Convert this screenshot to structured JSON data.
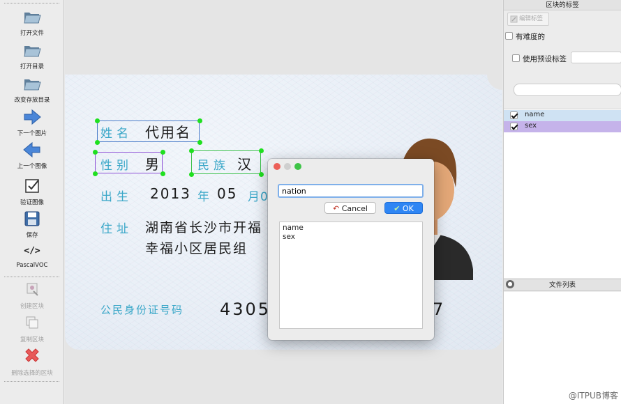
{
  "toolbar": {
    "open_file": "打开文件",
    "open_dir": "打开目录",
    "change_save_dir": "改变存放目录",
    "next_image": "下一个图片",
    "prev_image": "上一个图像",
    "verify_image": "验证图像",
    "save": "保存",
    "format_icon": "</>",
    "format": "PascalVOC",
    "create_box": "创建区块",
    "duplicate_box": "复制区块",
    "delete_box": "删除选择的区块"
  },
  "card": {
    "name_label": "姓名",
    "name_value": "代用名",
    "sex_label": "性别",
    "sex_value": "男",
    "nation_label": "民族",
    "nation_value": "汉",
    "birth_label": "出生",
    "birth_year": "2013",
    "year_char": "年",
    "birth_month": "05",
    "month_partial": "月0",
    "address_label": "住址",
    "address_line1": "湖南省长沙市开福",
    "address_line2": "幸福小区居民组",
    "id_label": "公民身份证号码",
    "id_left": "4305",
    "id_right": "7"
  },
  "dialog": {
    "input_value": "nation",
    "cancel_label": "Cancel",
    "ok_label": "OK",
    "list": [
      "name",
      "sex"
    ]
  },
  "right_panel": {
    "title": "区块的标签",
    "edit_label": "编辑标签",
    "difficult": "有难度的",
    "use_default_label": "使用预设标签",
    "labels": [
      {
        "text": "name",
        "checked": true,
        "color": "#cfe2f3"
      },
      {
        "text": "sex",
        "checked": true,
        "color": "#c5b3ea"
      }
    ],
    "file_list_title": "文件列表"
  },
  "watermark": "@ITPUB博客",
  "colors": {
    "accent": "#2f86f4",
    "handle": "#1fe01f",
    "name_box": "#4a7cc9",
    "sex_box": "#8c4fd6",
    "nation_box": "#3bc14a",
    "card_label": "#3aa7c8"
  }
}
